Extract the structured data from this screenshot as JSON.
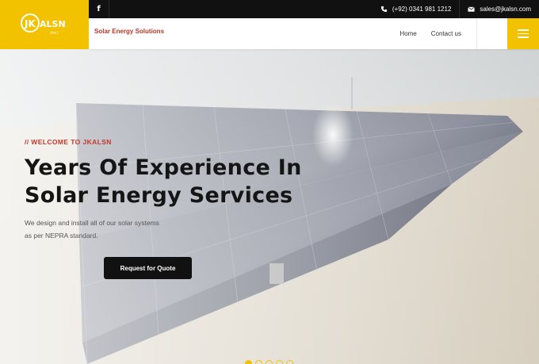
{
  "brand": {
    "logo_text": "JKALSN",
    "logo_subtext": "(Pvt.)",
    "tagline": "Solar Energy Solutions"
  },
  "topbar": {
    "facebook_icon": "facebook-icon",
    "phone": "(+92) 0341 981 1212",
    "email": "sales@jkalsn.com"
  },
  "nav": {
    "items": [
      {
        "label": "Home"
      },
      {
        "label": "Contact us"
      }
    ],
    "menu_icon": "hamburger-menu-icon"
  },
  "hero": {
    "eyebrow": "// WELCOME TO JKALSN",
    "headline": "Years Of Experience In Solar Energy Services",
    "subtext": "We design and install all of our solar systems as per NEPRA standard.",
    "cta_label": "Request for Quote",
    "slides": {
      "count": 5,
      "active_index": 0
    }
  },
  "colors": {
    "accent": "#f2c200",
    "dark": "#111111",
    "eyebrow": "#c0392b",
    "tagline": "#b13a2a"
  }
}
